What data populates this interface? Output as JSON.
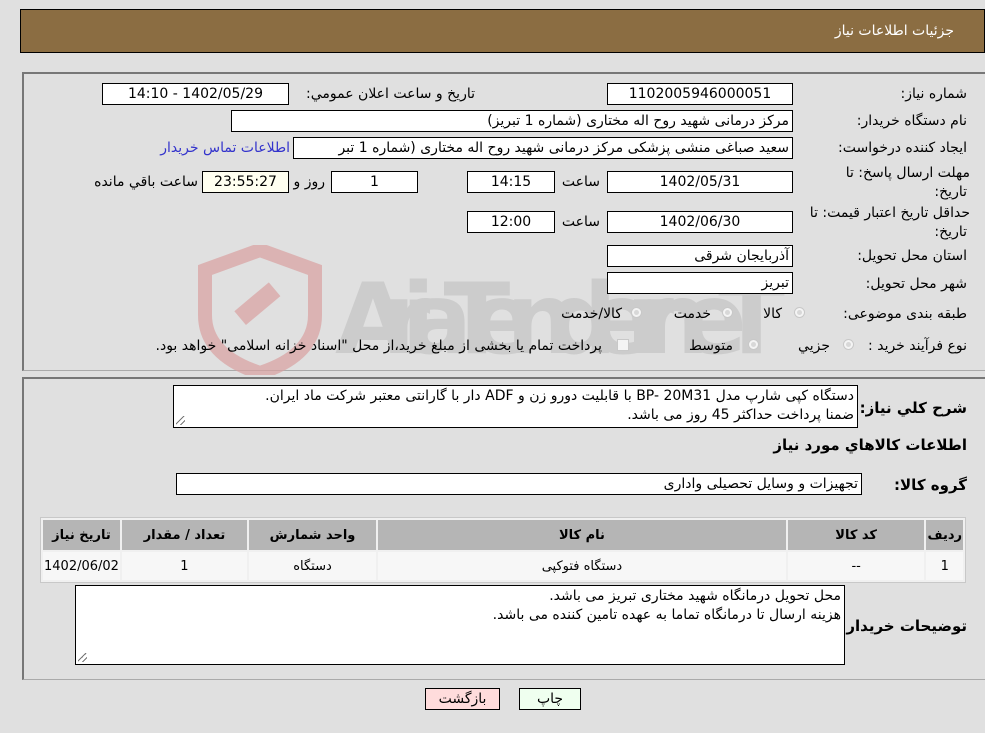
{
  "header": {
    "title": "جزئیات اطلاعات نیاز"
  },
  "form": {
    "need_number": {
      "label": "شماره نیاز:",
      "value": "1102005946000051"
    },
    "announce": {
      "label": "تاریخ و ساعت اعلان عمومي:",
      "value": "1402/05/29 - 14:10"
    },
    "buyer_org": {
      "label": "نام دستگاه خریدار:",
      "value": "مرکز درمانی شهید روح اله مختاری (شماره 1 تبریز)"
    },
    "requester": {
      "label": "ایجاد کننده درخواست:",
      "value": "سعید صباغی منشی  پزشکی مرکز درمانی شهید روح اله مختاری (شماره 1 تبر",
      "contact_link": "اطلاعات تماس خریدار"
    },
    "reply_deadline": {
      "label_line1": "مهلت ارسال پاسخ: تا",
      "label_line2": "تاریخ:",
      "date": "1402/05/31",
      "time_label": "ساعت",
      "time": "14:15",
      "days": "1",
      "days_label": "روز و",
      "remaining": "23:55:27",
      "remaining_label": "ساعت باقي مانده"
    },
    "price_validity": {
      "label_line1": "حداقل تاریخ اعتبار قیمت: تا",
      "label_line2": "تاریخ:",
      "date": "1402/06/30",
      "time_label": "ساعت",
      "time": "12:00"
    },
    "province": {
      "label": "استان محل تحویل:",
      "value": "آذربایجان شرقی"
    },
    "city": {
      "label": "شهر محل تحویل:",
      "value": "تبریز"
    },
    "category": {
      "label": "طبقه بندی موضوعی:",
      "options": [
        "کالا",
        "خدمت",
        "کالا/خدمت"
      ]
    },
    "process": {
      "label": "نوع فرآیند خرید :",
      "options": [
        "جزيي",
        "متوسط"
      ],
      "note": "پرداخت تمام یا بخشی از مبلغ خرید،از محل \"اسناد خزانه اسلامی\" خواهد بود."
    }
  },
  "details": {
    "description_label": "شرح کلي نیاز:",
    "description_lines": [
      "دستگاه کپی شارپ مدل BP- 20M31 با قابلیت دورو زن و ADF دار با گارانتی معتبر شرکت ماد ایران.",
      "ضمنا پرداخت حداکثر 45 روز می باشد."
    ],
    "goods_info_title": "اطلاعات کالاهاي مورد نیاز",
    "goods_group_label": "گروه کالا:",
    "goods_group_value": "تجهیزات و وسایل تحصیلی واداری"
  },
  "table": {
    "headers": [
      "ردیف",
      "کد کالا",
      "نام کالا",
      "واحد شمارش",
      "تعداد / مقدار",
      "تاریخ نیاز"
    ],
    "rows": [
      [
        "1",
        "--",
        "دستگاه فتوکپی",
        "دستگاه",
        "1",
        "1402/06/02"
      ]
    ]
  },
  "buyer_notes": {
    "label": "توضیحات خریدار:",
    "lines": [
      "محل تحویل درمانگاه شهید مختاری تبریز می باشد.",
      "هزینه ارسال تا درمانگاه تماما به عهده تامین کننده می باشد."
    ]
  },
  "buttons": {
    "print": "چاپ",
    "back": "بازگشت"
  },
  "colors": {
    "header_bg": "#8b6d42",
    "print_bg": "#efffef",
    "back_bg": "#ffdcdc",
    "link": "#3333cc"
  },
  "watermark": {
    "text": "AriaTender.neT"
  }
}
